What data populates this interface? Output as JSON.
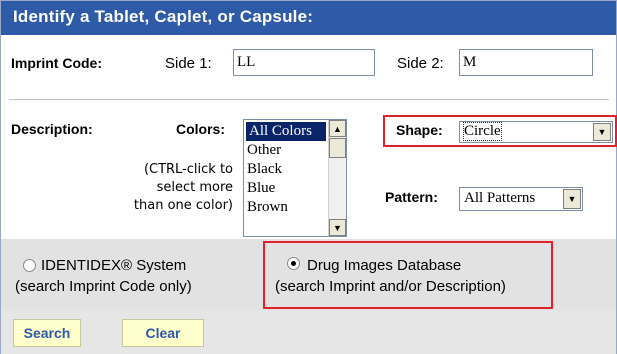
{
  "header": {
    "title": "Identify a Tablet, Caplet, or Capsule:"
  },
  "imprint": {
    "label": "Imprint Code:",
    "side1_label": "Side 1:",
    "side1_value": "LL",
    "side2_label": "Side 2:",
    "side2_value": "M"
  },
  "description": {
    "label": "Description:",
    "colors_label": "Colors:",
    "colors_hint": [
      "(CTRL-click to",
      "select more",
      "than one color)"
    ],
    "colors_options": [
      "All Colors",
      "Other",
      "Black",
      "Blue",
      "Brown"
    ],
    "shape_label": "Shape:",
    "shape_value": "Circle",
    "pattern_label": "Pattern:",
    "pattern_value": "All Patterns"
  },
  "search_options": {
    "identidex_line1": "IDENTIDEX® System",
    "identidex_line2": "(search Imprint Code only)",
    "drug_images_line1": "Drug Images Database",
    "drug_images_line2": "(search Imprint and/or Description)"
  },
  "buttons": {
    "search": "Search",
    "clear": "Clear"
  },
  "colors": {
    "header_bg": "#2f5aa8",
    "highlight": "#e0202a",
    "button_bg": "#ffffcc"
  }
}
